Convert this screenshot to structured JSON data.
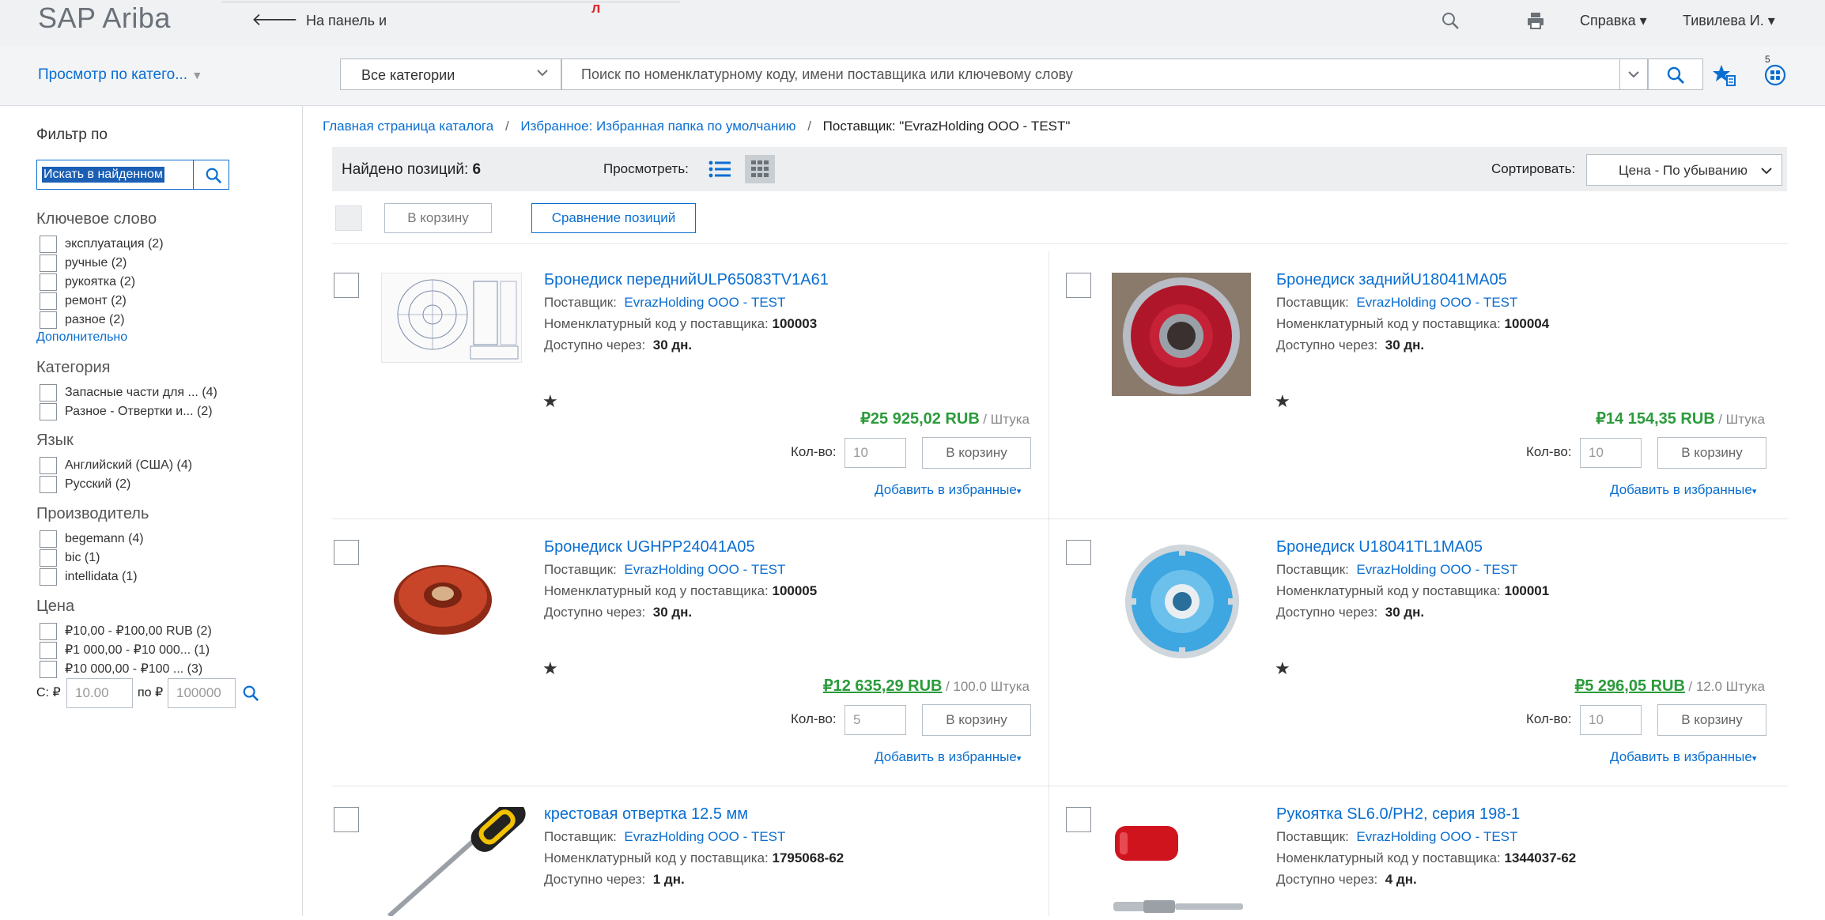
{
  "header": {
    "logo": "SAP Ariba",
    "back_label": "На панель и",
    "red_mark": "л",
    "help_label": "Справка ▾",
    "user_label": "Тивилева И. ▾"
  },
  "searchbar": {
    "browse_label": "Просмотр по катего...",
    "category_select": "Все категории",
    "search_placeholder": "Поиск по номенклатурному коду, имени поставщика или ключевому слову",
    "badge_count": "5"
  },
  "sidebar": {
    "title": "Фильтр по",
    "search_value": "Искать в найденном",
    "keyword": {
      "title": "Ключевое слово",
      "items": [
        {
          "label": "эксплуатация  (2)"
        },
        {
          "label": "ручные  (2)"
        },
        {
          "label": "рукоятка  (2)"
        },
        {
          "label": "ремонт  (2)"
        },
        {
          "label": "разное  (2)"
        }
      ],
      "more": "Дополнительно"
    },
    "category": {
      "title": "Категория",
      "items": [
        {
          "label": "Запасные части для ...  (4)"
        },
        {
          "label": "Разное - Отвертки и...  (2)"
        }
      ]
    },
    "language": {
      "title": "Язык",
      "items": [
        {
          "label": "Английский (США)  (4)"
        },
        {
          "label": "Русский  (2)"
        }
      ]
    },
    "manufacturer": {
      "title": "Производитель",
      "items": [
        {
          "label": "begemann  (4)"
        },
        {
          "label": "bic  (1)"
        },
        {
          "label": "intellidata  (1)"
        }
      ]
    },
    "price": {
      "title": "Цена",
      "items": [
        {
          "label": "₽10,00 - ₽100,00 RUB  (2)"
        },
        {
          "label": "₽1 000,00 - ₽10 000...  (1)"
        },
        {
          "label": "₽10 000,00 - ₽100 ...  (3)"
        }
      ],
      "from_label": "С: ₽",
      "from_placeholder": "10.00",
      "to_label": "по ₽",
      "to_placeholder": "100000"
    }
  },
  "breadcrumb": {
    "home": "Главная страница каталога",
    "sep": "/",
    "favorites": "Избранное: Избранная папка по умолчанию",
    "current": "Поставщик: \"EvrazHolding ООО - TEST\""
  },
  "results": {
    "found_label": "Найдено позиций:",
    "found_count": "6",
    "view_label": "Просмотреть:",
    "sort_label": "Сортировать:",
    "sort_value": "Цена - По убыванию",
    "add_to_cart_label": "В корзину",
    "compare_label": "Сравнение позиций"
  },
  "labels": {
    "supplier": "Поставщик:",
    "code": "Номенклатурный код у поставщика:",
    "available": "Доступно через:",
    "qty": "Кол-во:",
    "cart": "В корзину",
    "favorites": "Добавить в избранные",
    "star": "★"
  },
  "products": [
    {
      "title": "Бронедиск переднийULP65083TV1A61",
      "supplier": "EvrazHolding ООО - TEST",
      "code": "100003",
      "days": "30 дн.",
      "price": "₽25 925,02 RUB",
      "unit": "/ Штука",
      "qty": "10"
    },
    {
      "title": "Бронедиск заднийU18041MA05",
      "supplier": "EvrazHolding ООО - TEST",
      "code": "100004",
      "days": "30 дн.",
      "price": "₽14 154,35 RUB",
      "unit": "/ Штука",
      "qty": "10"
    },
    {
      "title": "Бронедиск UGHPP24041A05",
      "supplier": "EvrazHolding ООО - TEST",
      "code": "100005",
      "days": "30 дн.",
      "price": "₽12 635,29 RUB",
      "unit": "/ 100.0 Штука",
      "qty": "5"
    },
    {
      "title": "Бронедиск U18041TL1MA05",
      "supplier": "EvrazHolding ООО - TEST",
      "code": "100001",
      "days": "30 дн.",
      "price": "₽5 296,05 RUB",
      "unit": "/ 12.0 Штука",
      "qty": "10"
    },
    {
      "title": "крестовая отвертка 12.5 мм",
      "supplier": "EvrazHolding ООО - TEST",
      "code": "1795068-62",
      "days": "1 дн."
    },
    {
      "title": "Рукоятка SL6.0/PH2, серия 198-1",
      "supplier": "EvrazHolding ООО - TEST",
      "code": "1344037-62",
      "days": "4 дн."
    }
  ]
}
